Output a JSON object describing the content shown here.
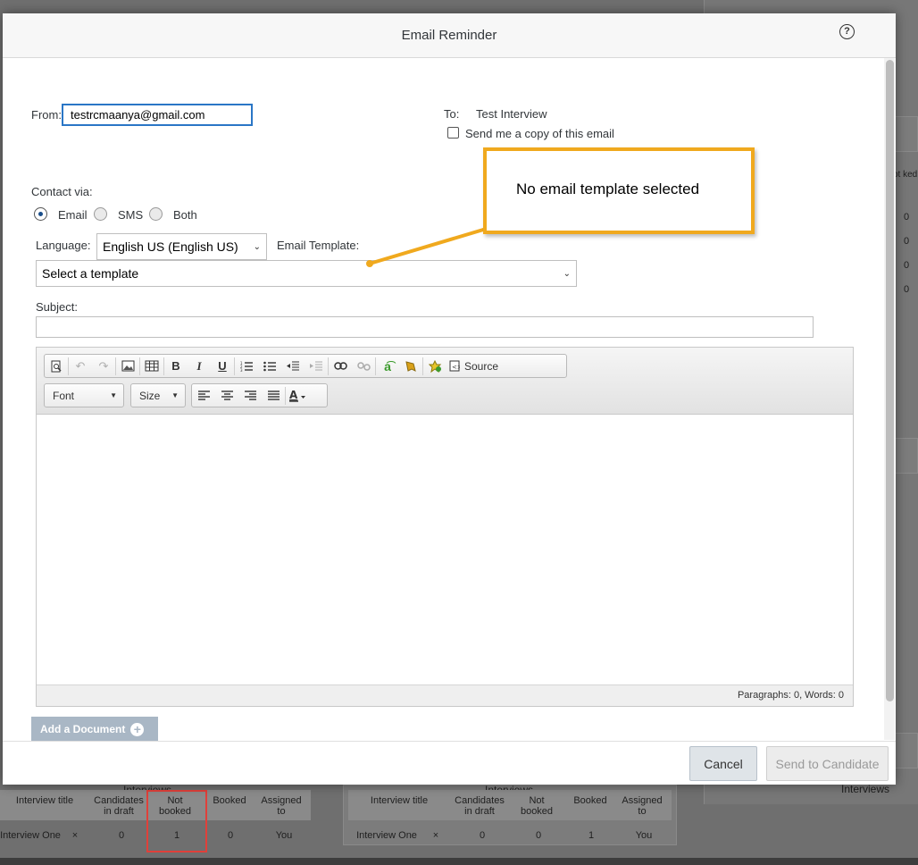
{
  "background": {
    "left_table": {
      "group_label": "Interviews",
      "headers": [
        "Interview title",
        "Candidates in draft",
        "Not booked",
        "Booked",
        "Assigned to"
      ],
      "row": [
        "Interview One",
        "×",
        "0",
        "1",
        "0",
        "You"
      ]
    },
    "right_table": {
      "group_label": "Interviews",
      "headers": [
        "Interview title",
        "Candidates in draft",
        "Not booked",
        "Booked",
        "Assigned to"
      ],
      "row": [
        "Interview One",
        "×",
        "0",
        "0",
        "1",
        "You"
      ]
    },
    "right_panel": {
      "group_label": "Interviews",
      "snippet_header": "ot\nked",
      "values": [
        "0",
        "0",
        "0",
        "0"
      ]
    }
  },
  "dialog": {
    "title": "Email Reminder",
    "help_icon": "?",
    "from_label": "From:",
    "from_value": "testrcmaanya@gmail.com",
    "to_label": "To:",
    "to_value": "Test Interview",
    "copy_label": "Send me a copy of this email",
    "contact_label": "Contact via:",
    "contact_options": [
      "Email",
      "SMS",
      "Both"
    ],
    "contact_selected": "Email",
    "language_label": "Language:",
    "language_value": "English US (English US)",
    "template_label": "Email Template:",
    "template_placeholder": "Select a template",
    "subject_label": "Subject:",
    "subject_value": "",
    "editor": {
      "font_combo": "Font",
      "size_combo": "Size",
      "source_label": "Source",
      "status": "Paragraphs: 0, Words: 0"
    },
    "add_document_label": "Add a Document",
    "cancel_label": "Cancel",
    "send_label": "Send to Candidate"
  },
  "callout": {
    "text": "No email template selected",
    "border_color": "#f0a91e"
  },
  "colors": {
    "focus_border": "#2a76c6",
    "highlight_box": "#e0403a",
    "add_doc_button": "#a9b7c5"
  }
}
